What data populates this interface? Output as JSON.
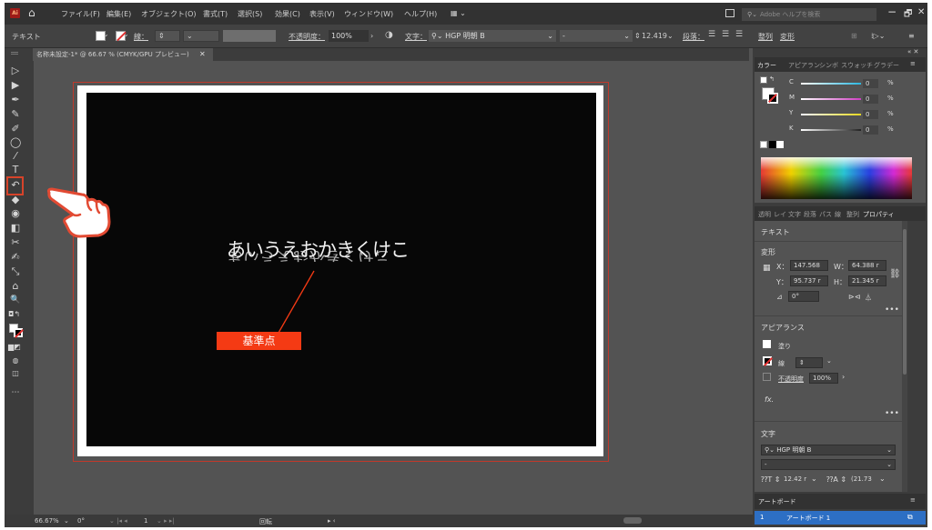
{
  "app": {
    "logo": "Ai",
    "home_icon": "home-icon"
  },
  "menu": {
    "items": [
      "ファイル(F)",
      "編集(E)",
      "オブジェクト(O)",
      "書式(T)",
      "選択(S)",
      "効果(C)",
      "表示(V)",
      "ウィンドウ(W)",
      "ヘルプ(H)"
    ],
    "workspace_icon": "▦ ⌄",
    "search_placeholder": "Adobe ヘルプを検索",
    "window_buttons": [
      "−",
      "🗗",
      "✕"
    ]
  },
  "control_bar": {
    "object_type": "テキスト",
    "stroke_label": "線：",
    "opacity_label": "不透明度：",
    "opacity_value": "100%",
    "char_label": "文字：",
    "font_value": "HGP 明朝 B",
    "style_value": "-",
    "size_value": "12.419",
    "paragraph_label": "段落：",
    "align_label": "整列",
    "transform_label": "変形"
  },
  "document_tab": {
    "title": "名称未設定-1* @ 66.67 % (CMYK/GPU プレビュー)",
    "close": "✕"
  },
  "tools": [
    "▷",
    "▶",
    "✒",
    "✎",
    "✐",
    "◯",
    "⁄",
    "T",
    "↶",
    "◆",
    "◉",
    "◧",
    "✂",
    "✍",
    "⤡",
    "⌂",
    "🔍"
  ],
  "canvas": {
    "text_glyphs": "あいうえおかきくけこ",
    "ref_point_label": "基準点"
  },
  "status_bar": {
    "zoom": "66.67%",
    "angle": "0°",
    "artboard_num": "1",
    "mode": "回転"
  },
  "color_panel": {
    "tabs": [
      "カラー",
      "アピアラン",
      "シンボ",
      "スウォッチ",
      "グラデー"
    ],
    "channels": [
      {
        "label": "C",
        "value": "0",
        "unit": "%",
        "color": "#2bb7e0"
      },
      {
        "label": "M",
        "value": "0",
        "unit": "%",
        "color": "#d03fc4"
      },
      {
        "label": "Y",
        "value": "0",
        "unit": "%",
        "color": "#e6d822"
      },
      {
        "label": "K",
        "value": "0",
        "unit": "%",
        "color": "#555555"
      }
    ]
  },
  "properties_panel": {
    "tabs": [
      "透明",
      "レイ",
      "文字",
      "段落",
      "パス",
      "線",
      "整列",
      "プロパティ"
    ],
    "object_type": "テキスト",
    "transform_label": "変形",
    "x_label": "X：",
    "x_value": "147.568",
    "y_label": "Y：",
    "y_value": "95.737 r",
    "w_label": "W：",
    "w_value": "64.388 r",
    "h_label": "H：",
    "h_value": "21.345 r",
    "angle_label": "⊿",
    "angle_value": "0°",
    "appearance_label": "アピアランス",
    "fill_label": "塗り",
    "stroke_label": "線",
    "opacity_label": "不透明度",
    "opacity_value": "100%",
    "fx_label": "fx.",
    "char_label": "文字",
    "font_value": "HGP 明朝 B",
    "style_value": "-",
    "size_value": "12.42 r",
    "leading_value": "(21.73"
  },
  "artboard_panel": {
    "tab": "アートボード",
    "row_num": "1",
    "row_name": "アートボード 1"
  }
}
